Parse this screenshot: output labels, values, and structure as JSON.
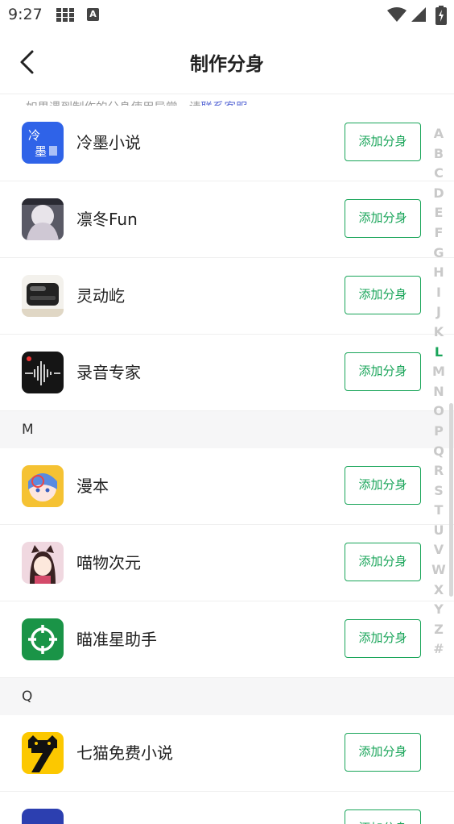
{
  "status_bar": {
    "time": "9:27",
    "icons": [
      "grid-icon",
      "a-icon",
      "wifi-icon",
      "signal-icon",
      "battery-icon"
    ],
    "a_icon_label": "A"
  },
  "header": {
    "title": "制作分身",
    "back_icon": "chevron-left-icon"
  },
  "notice": {
    "text": "如果遇到制作的分身使用异常，请",
    "link": "联系客服"
  },
  "colors": {
    "accent": "#1aa55a",
    "link": "#5b6bd6",
    "section_bg": "#f6f6f7"
  },
  "add_button_label": "添加分身",
  "groups": [
    {
      "letter": "",
      "apps": [
        {
          "name": "冷墨小说",
          "icon": "lengmo-app-icon"
        },
        {
          "name": "凛冬Fun",
          "icon": "lindong-app-icon"
        },
        {
          "name": "灵动屹",
          "icon": "lingdong-app-icon"
        },
        {
          "name": "录音专家",
          "icon": "recorder-app-icon"
        }
      ]
    },
    {
      "letter": "M",
      "apps": [
        {
          "name": "漫本",
          "icon": "manben-app-icon"
        },
        {
          "name": "喵物次元",
          "icon": "miaowu-app-icon"
        },
        {
          "name": "瞄准星助手",
          "icon": "crosshair-app-icon"
        }
      ]
    },
    {
      "letter": "Q",
      "apps": [
        {
          "name": "七猫免费小说",
          "icon": "qimao-app-icon"
        }
      ]
    }
  ],
  "index_bar": {
    "letters": [
      "A",
      "B",
      "C",
      "D",
      "E",
      "F",
      "G",
      "H",
      "I",
      "J",
      "K",
      "L",
      "M",
      "N",
      "O",
      "P",
      "Q",
      "R",
      "S",
      "T",
      "U",
      "V",
      "W",
      "X",
      "Y",
      "Z",
      "#"
    ],
    "active": "L"
  }
}
